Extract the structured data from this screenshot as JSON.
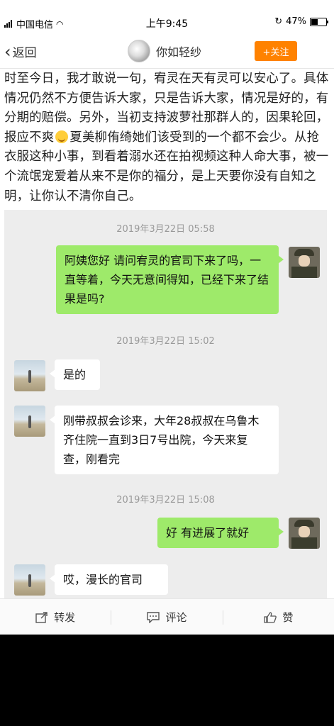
{
  "status_bar": {
    "carrier": "中国电信",
    "time": "上午9:45",
    "battery": "47%",
    "battery_level": 0.47
  },
  "nav": {
    "back_label": "返回",
    "username": "你如轻纱",
    "follow_label": "+关注"
  },
  "post": {
    "part1": "时至今日，我才敢说一句，宥灵在天有灵可以安心了。具体情况仍然不方便告诉大家，只是告诉大家，情况是好的，有分期的赔偿。另外，当初支持波萝社那群人的，因果轮回，报应不爽",
    "part2": "夏美柳侑绮她们该受到的一个都不会少。从抢衣服这种小事，到看着溺水还在拍视频这种人命大事，被一个流氓宠爱着从来不是你的福分，是上天要你没有自知之明，让你认不清你自己。"
  },
  "chat": {
    "timestamps": [
      "2019年3月22日 05:58",
      "2019年3月22日 15:02",
      "2019年3月22日 15:08"
    ],
    "messages": [
      {
        "sender": "me",
        "text": "阿姨您好 请问宥灵的官司下来了吗，一直等着，今天无意间得知，已经下来了结果是吗?"
      },
      {
        "sender": "them",
        "text": "是的"
      },
      {
        "sender": "them",
        "text": "刚带叔叔会诊来，大年28叔叔在乌鲁木齐住院一直到3日7号出院，今天来复查，刚看完"
      },
      {
        "sender": "me",
        "text": "好 有进展了就好"
      },
      {
        "sender": "them",
        "text": "哎，漫长的官司"
      }
    ]
  },
  "toolbar": {
    "repost_label": "转发",
    "comment_label": "评论",
    "like_label": "赞"
  }
}
